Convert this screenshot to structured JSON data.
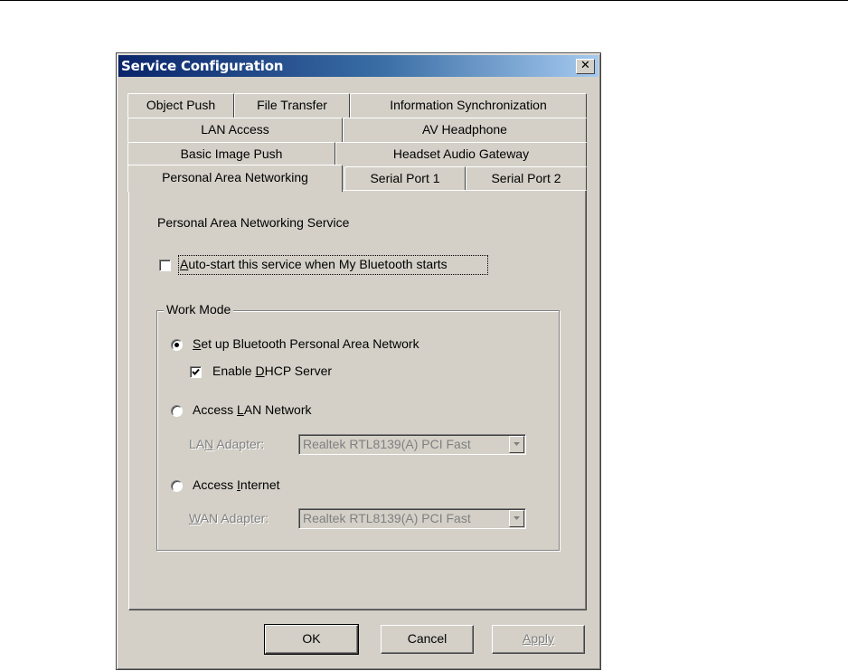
{
  "window": {
    "title": "Service Configuration",
    "close_glyph": "✕"
  },
  "tabs": {
    "row1": [
      "Object Push",
      "File Transfer",
      "Information Synchronization"
    ],
    "row2": [
      "LAN Access",
      "AV Headphone"
    ],
    "row3": [
      "Basic Image Push",
      "Headset Audio Gateway"
    ],
    "row4": [
      "Personal Area Networking",
      "Serial Port 1",
      "Serial Port 2"
    ],
    "active": "Personal Area Networking"
  },
  "panel": {
    "service_label": "Personal Area Networking Service",
    "autostart": {
      "mnemonic": "A",
      "rest": "uto-start this service when My Bluetooth starts",
      "checked": false
    },
    "work_mode": {
      "title": "Work Mode",
      "option_pan": {
        "mnemonic": "S",
        "rest": "et up Bluetooth Personal Area Network",
        "selected": true
      },
      "dhcp": {
        "pre": "Enable ",
        "mnemonic": "D",
        "rest": "HCP Server",
        "checked": true
      },
      "option_lan": {
        "pre": "Access ",
        "mnemonic": "L",
        "rest": "AN Network",
        "selected": false
      },
      "lan_adapter": {
        "pre": "LA",
        "mnemonic": "N",
        "rest": " Adapter:",
        "value": "Realtek RTL8139(A) PCI Fast",
        "enabled": false
      },
      "option_internet": {
        "pre": "Access ",
        "mnemonic": "I",
        "rest": "nternet",
        "selected": false
      },
      "wan_adapter": {
        "mnemonic": "W",
        "rest": "AN Adapter:",
        "value": "Realtek RTL8139(A) PCI Fast",
        "enabled": false
      }
    }
  },
  "buttons": {
    "ok": "OK",
    "cancel": "Cancel",
    "apply": "Apply",
    "apply_enabled": false
  }
}
